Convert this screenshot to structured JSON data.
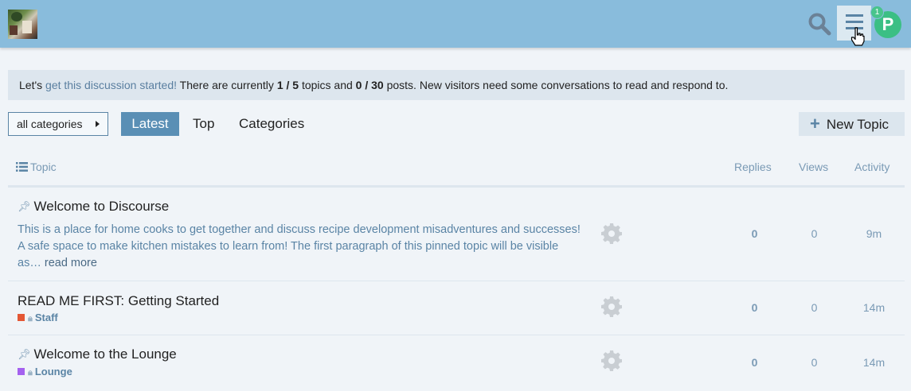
{
  "header": {
    "logo_name": "site-logo",
    "notification_count": "1",
    "avatar_letter": "P",
    "colors": {
      "header_bg": "#89bcdc",
      "avatar": "#3bbf84",
      "accent": "#5a8fb5"
    }
  },
  "notice": {
    "prefix": "Let's ",
    "link": "get this discussion started!",
    "mid1": " There are currently ",
    "topics": "1 / 5",
    "mid2": " topics and ",
    "posts": "0 / 30",
    "suffix": " posts. New visitors need some conversations to read and respond to."
  },
  "nav": {
    "category_dropdown": "all categories",
    "tabs": [
      "Latest",
      "Top",
      "Categories"
    ],
    "new_topic": "New Topic"
  },
  "table": {
    "headers": {
      "topic": "Topic",
      "replies": "Replies",
      "views": "Views",
      "activity": "Activity"
    },
    "rows": [
      {
        "title": "Welcome to Discourse",
        "pinned": true,
        "excerpt": "This is a place for home cooks to get together and discuss recipe development misadventures and successes! A safe space to make kitchen mistakes to learn from! The first paragraph of this pinned topic will be visible as…",
        "read_more": "read more",
        "replies": "0",
        "views": "0",
        "activity": "9m"
      },
      {
        "title": "READ ME FIRST: Getting Started",
        "pinned": false,
        "category": "Staff",
        "category_color": "#e45735",
        "replies": "0",
        "views": "0",
        "activity": "14m"
      },
      {
        "title": "Welcome to the Lounge",
        "pinned": true,
        "category": "Lounge",
        "category_color": "#a461ef",
        "replies": "0",
        "views": "0",
        "activity": "14m"
      }
    ]
  }
}
